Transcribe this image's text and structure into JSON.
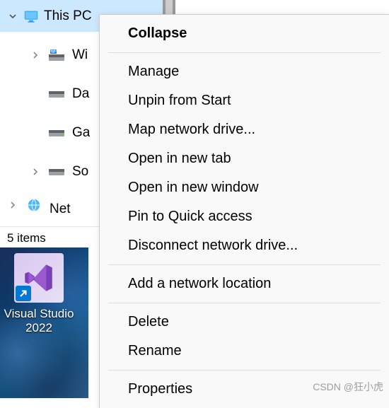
{
  "tree": {
    "selected": {
      "label": "This PC"
    },
    "children": [
      {
        "label": "Windows (C:)",
        "short": "Wi"
      },
      {
        "label": "Data (D:)",
        "short": "Da"
      },
      {
        "label": "Games (G:)",
        "short": "Ga"
      },
      {
        "label": "Software (S:)",
        "short": "So"
      },
      {
        "label": "Network",
        "short": "Network"
      }
    ]
  },
  "status": {
    "text": "5 items"
  },
  "desktop": {
    "shortcut_name": "Visual Studio 2022"
  },
  "context_menu": {
    "bold": "Collapse",
    "group1": [
      "Manage",
      "Unpin from Start",
      "Map network drive...",
      "Open in new tab",
      "Open in new window",
      "Pin to Quick access",
      "Disconnect network drive..."
    ],
    "group2": [
      "Add a network location"
    ],
    "group3": [
      "Delete",
      "Rename"
    ],
    "group4": [
      "Properties"
    ]
  },
  "watermark": "CSDN @狂小虎"
}
